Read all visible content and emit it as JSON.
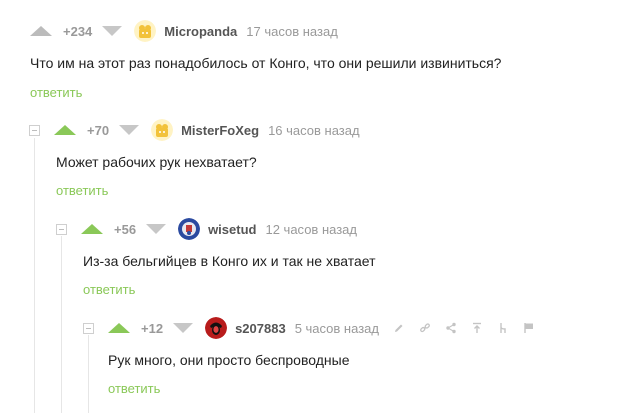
{
  "colors": {
    "accent": "#8ac858",
    "muted": "#999999",
    "text": "#222222"
  },
  "comments": [
    {
      "rating": "+234",
      "author": "Micropanda",
      "time": "17 часов назад",
      "text": "Что им на этот раз понадобилось от Конго, что они решили извиниться?",
      "reply": "ответить",
      "avatar": "panda-avatar"
    },
    {
      "rating": "+70",
      "author": "MisterFoXeg",
      "time": "16 часов назад",
      "text": "Может рабочих рук нехватает?",
      "reply": "ответить",
      "avatar": "panda-avatar"
    },
    {
      "rating": "+56",
      "author": "wisetud",
      "time": "12 часов назад",
      "text": "Из-за бельгийцев в Конго их и так не хватает",
      "reply": "ответить",
      "avatar": "emblem-avatar"
    },
    {
      "rating": "+12",
      "author": "s207883",
      "time": "5 часов назад",
      "text": "Рук много, они просто беспроводные",
      "reply": "ответить",
      "avatar": "portrait-avatar",
      "tools": [
        "edit-icon",
        "link-icon",
        "share-icon",
        "go-to-parent-icon",
        "branch-icon",
        "report-flag-icon"
      ]
    }
  ]
}
